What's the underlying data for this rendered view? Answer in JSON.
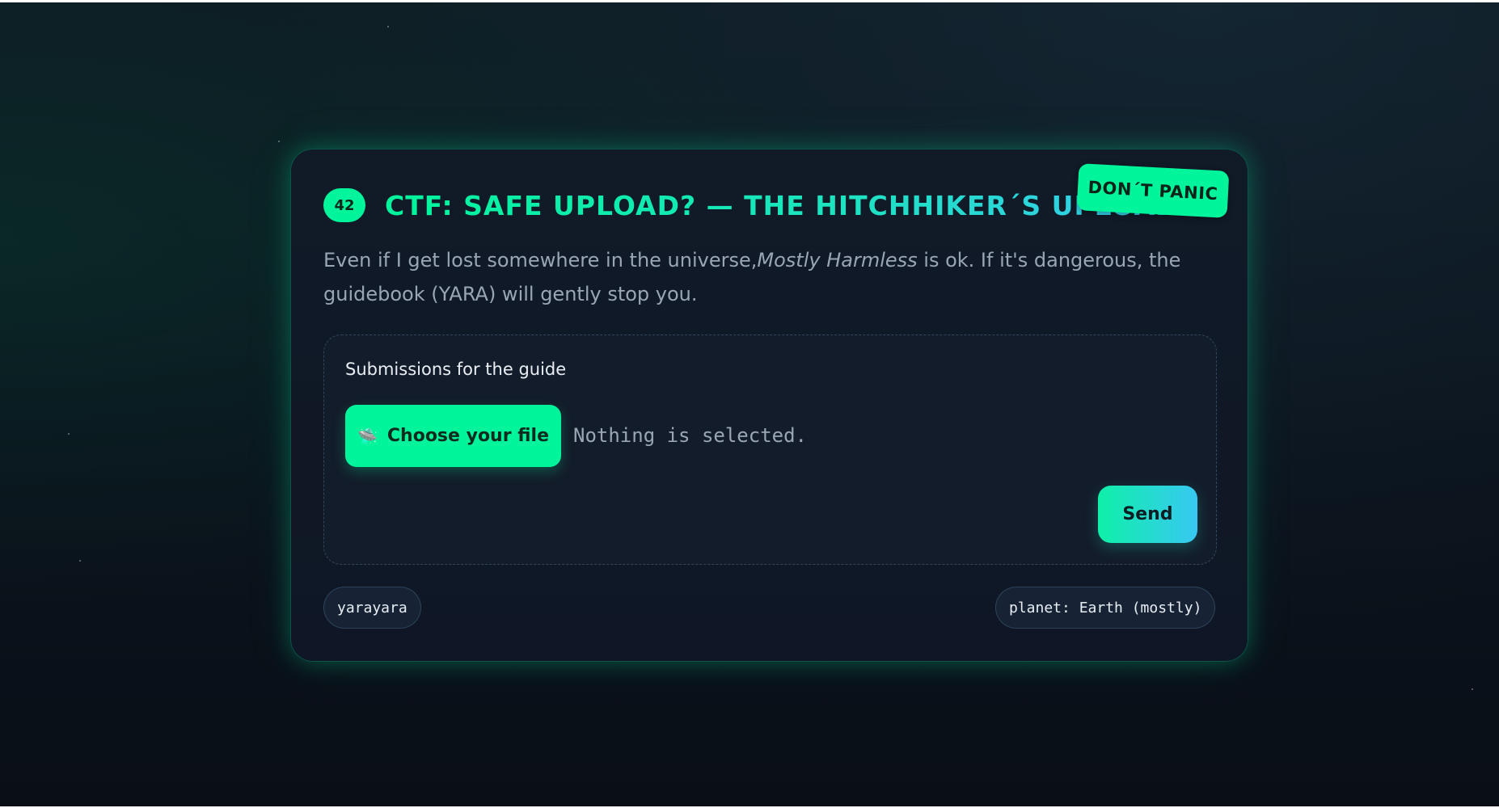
{
  "card": {
    "badge": "42",
    "title": "CTF: SAFE UPLOAD? — THE HITCHHIKER´S UPLOADER",
    "sticker": "DON´T PANIC",
    "description": {
      "before": "Even if I get lost somewhere in the universe,",
      "emphasis": "Mostly Harmless",
      "after": " is ok. If it's dangerous, the guidebook (YARA) will gently stop you."
    }
  },
  "upload": {
    "label": "Submissions for the guide",
    "choose_icon": "🛸",
    "choose_label": "Choose your file",
    "status": "Nothing is selected.",
    "send_label": "Send"
  },
  "footer": {
    "left_tag": "yarayara",
    "right_tag": "planet: Earth (mostly)"
  },
  "colors": {
    "accent": "#00f59b",
    "accent_secondary": "#38c8f2",
    "card_bg": "#111a27",
    "text_muted": "#9aa6b4"
  },
  "icons": {
    "choose_button": "ufo-icon"
  }
}
